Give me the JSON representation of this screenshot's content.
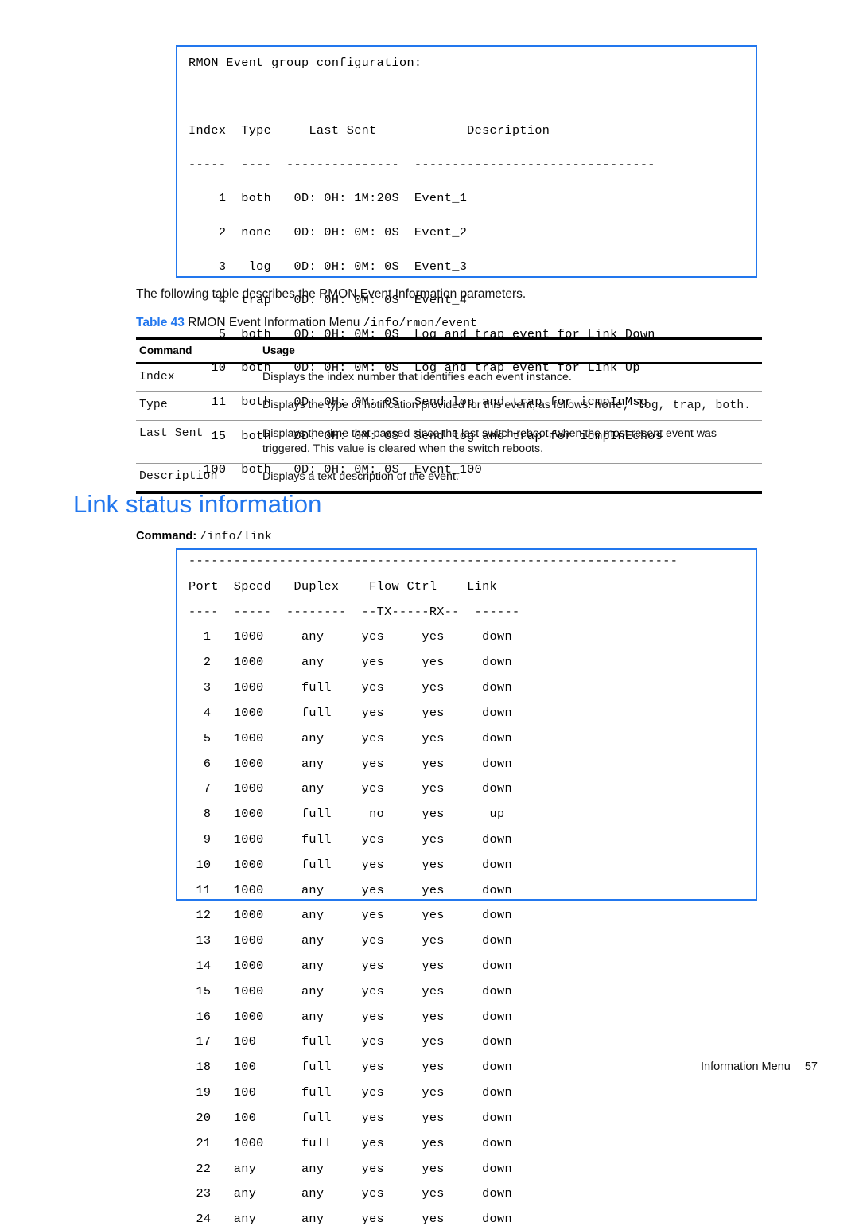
{
  "rmon_console": {
    "lines": [
      "RMON Event group configuration:",
      "",
      "Index  Type     Last Sent            Description",
      "-----  ----  ---------------  --------------------------------",
      "    1  both   0D: 0H: 1M:20S  Event_1",
      "    2  none   0D: 0H: 0M: 0S  Event_2",
      "    3   log   0D: 0H: 0M: 0S  Event_3",
      "    4  trap   0D: 0H: 0M: 0S  Event_4",
      "    5  both   0D: 0H: 0M: 0S  Log and trap event for Link Down",
      "   10  both   0D: 0H: 0M: 0S  Log and trap event for Link Up",
      "   11  both   0D: 0H: 0M: 0S  Send log and trap for icmpInMsg",
      "   15  both   0D: 0H: 0M: 0S  Send log and trap for icmpInEchos",
      "  100  both   0D: 0H: 0M: 0S  Event_100"
    ]
  },
  "intro": {
    "paragraph": "The following table describes the RMON Event Information parameters."
  },
  "table_caption": {
    "number": "Table 43",
    "title": "RMON Event Information Menu",
    "command": "/info/rmon/event"
  },
  "params_table": {
    "headers": [
      "Command",
      "Usage"
    ],
    "rows": [
      {
        "command": "Index",
        "usage_plain": "Displays the index number that identifies each event instance.",
        "usage_pre": "Displays the index number that identifies each event instance.",
        "usage_mono": "",
        "usage_post": ""
      },
      {
        "command": "Type",
        "usage_plain": "Displays the type of notification provided for this event, as follows: none, log, trap, both.",
        "usage_pre": "Displays the type of notification provided for this event, as follows: ",
        "usage_mono": "none,  log,  trap,  both.",
        "usage_post": ""
      },
      {
        "command": "Last Sent",
        "usage_plain": "Displays the time that passed since the last switch reboot, when the most recent event was triggered. This value is cleared when the switch reboots.",
        "usage_pre": "Displays the time that passed since the last switch reboot, when the most recent event was triggered. This value is cleared when the switch reboots.",
        "usage_mono": "",
        "usage_post": ""
      },
      {
        "command": "Description",
        "usage_plain": "Displays a text description of the event.",
        "usage_pre": "Displays a text description of the event.",
        "usage_mono": "",
        "usage_post": ""
      }
    ]
  },
  "section": {
    "heading": "Link status information",
    "command_label": "Command:",
    "command_value": "/info/link"
  },
  "link_console": {
    "lines": [
      "-----------------------------------------------------------------",
      "Port  Speed   Duplex    Flow Ctrl    Link",
      "----  -----  --------  --TX-----RX--  ------",
      "  1   1000     any     yes     yes     down",
      "  2   1000     any     yes     yes     down",
      "  3   1000     full    yes     yes     down",
      "  4   1000     full    yes     yes     down",
      "  5   1000     any     yes     yes     down",
      "  6   1000     any     yes     yes     down",
      "  7   1000     any     yes     yes     down",
      "  8   1000     full     no     yes      up",
      "  9   1000     full    yes     yes     down",
      " 10   1000     full    yes     yes     down",
      " 11   1000     any     yes     yes     down",
      " 12   1000     any     yes     yes     down",
      " 13   1000     any     yes     yes     down",
      " 14   1000     any     yes     yes     down",
      " 15   1000     any     yes     yes     down",
      " 16   1000     any     yes     yes     down",
      " 17   100      full    yes     yes     down",
      " 18   100      full    yes     yes     down",
      " 19   100      full    yes     yes     down",
      " 20   100      full    yes     yes     down",
      " 21   1000     full    yes     yes     down",
      " 22   any      any     yes     yes     down",
      " 23   any      any     yes     yes     down",
      " 24   any      any     yes     yes     down"
    ],
    "columns": [
      "Port",
      "Speed",
      "Duplex",
      "Flow Ctrl TX",
      "Flow Ctrl RX",
      "Link"
    ],
    "rows": [
      {
        "port": "1",
        "speed": "1000",
        "duplex": "any",
        "tx": "yes",
        "rx": "yes",
        "link": "down"
      },
      {
        "port": "2",
        "speed": "1000",
        "duplex": "any",
        "tx": "yes",
        "rx": "yes",
        "link": "down"
      },
      {
        "port": "3",
        "speed": "1000",
        "duplex": "full",
        "tx": "yes",
        "rx": "yes",
        "link": "down"
      },
      {
        "port": "4",
        "speed": "1000",
        "duplex": "full",
        "tx": "yes",
        "rx": "yes",
        "link": "down"
      },
      {
        "port": "5",
        "speed": "1000",
        "duplex": "any",
        "tx": "yes",
        "rx": "yes",
        "link": "down"
      },
      {
        "port": "6",
        "speed": "1000",
        "duplex": "any",
        "tx": "yes",
        "rx": "yes",
        "link": "down"
      },
      {
        "port": "7",
        "speed": "1000",
        "duplex": "any",
        "tx": "yes",
        "rx": "yes",
        "link": "down"
      },
      {
        "port": "8",
        "speed": "1000",
        "duplex": "full",
        "tx": "no",
        "rx": "yes",
        "link": "up"
      },
      {
        "port": "9",
        "speed": "1000",
        "duplex": "full",
        "tx": "yes",
        "rx": "yes",
        "link": "down"
      },
      {
        "port": "10",
        "speed": "1000",
        "duplex": "full",
        "tx": "yes",
        "rx": "yes",
        "link": "down"
      },
      {
        "port": "11",
        "speed": "1000",
        "duplex": "any",
        "tx": "yes",
        "rx": "yes",
        "link": "down"
      },
      {
        "port": "12",
        "speed": "1000",
        "duplex": "any",
        "tx": "yes",
        "rx": "yes",
        "link": "down"
      },
      {
        "port": "13",
        "speed": "1000",
        "duplex": "any",
        "tx": "yes",
        "rx": "yes",
        "link": "down"
      },
      {
        "port": "14",
        "speed": "1000",
        "duplex": "any",
        "tx": "yes",
        "rx": "yes",
        "link": "down"
      },
      {
        "port": "15",
        "speed": "1000",
        "duplex": "any",
        "tx": "yes",
        "rx": "yes",
        "link": "down"
      },
      {
        "port": "16",
        "speed": "1000",
        "duplex": "any",
        "tx": "yes",
        "rx": "yes",
        "link": "down"
      },
      {
        "port": "17",
        "speed": "100",
        "duplex": "full",
        "tx": "yes",
        "rx": "yes",
        "link": "down"
      },
      {
        "port": "18",
        "speed": "100",
        "duplex": "full",
        "tx": "yes",
        "rx": "yes",
        "link": "down"
      },
      {
        "port": "19",
        "speed": "100",
        "duplex": "full",
        "tx": "yes",
        "rx": "yes",
        "link": "down"
      },
      {
        "port": "20",
        "speed": "100",
        "duplex": "full",
        "tx": "yes",
        "rx": "yes",
        "link": "down"
      },
      {
        "port": "21",
        "speed": "1000",
        "duplex": "full",
        "tx": "yes",
        "rx": "yes",
        "link": "down"
      },
      {
        "port": "22",
        "speed": "any",
        "duplex": "any",
        "tx": "yes",
        "rx": "yes",
        "link": "down"
      },
      {
        "port": "23",
        "speed": "any",
        "duplex": "any",
        "tx": "yes",
        "rx": "yes",
        "link": "down"
      },
      {
        "port": "24",
        "speed": "any",
        "duplex": "any",
        "tx": "yes",
        "rx": "yes",
        "link": "down"
      }
    ]
  },
  "footer": {
    "label": "Information Menu",
    "page": "57"
  },
  "colors": {
    "accent_blue": "#2277ee",
    "rule_black": "#000000",
    "rule_gray": "#9a9a9a"
  }
}
